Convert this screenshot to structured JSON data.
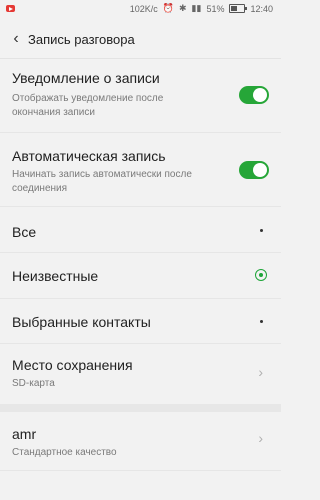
{
  "status": {
    "speed": "102K/c",
    "battery_percent": "51%",
    "time": "12:40"
  },
  "header": {
    "title": "Запись разговора"
  },
  "items": {
    "notification": {
      "label": "Уведомление о записи",
      "sub": "Отображать уведомление после окончания записи",
      "enabled": true
    },
    "auto": {
      "label": "Автоматическая запись",
      "sub": "Начинать запись автоматически после соединения",
      "enabled": true
    },
    "all": {
      "label": "Все"
    },
    "unknown": {
      "label": "Неизвестные",
      "selected": true
    },
    "selected_contacts": {
      "label": "Выбранные контакты"
    },
    "storage": {
      "label": "Место сохранения",
      "sub": "SD-карта"
    },
    "format": {
      "label": "amr",
      "sub": "Стандартное качество"
    }
  },
  "colors": {
    "accent": "#26a638"
  }
}
